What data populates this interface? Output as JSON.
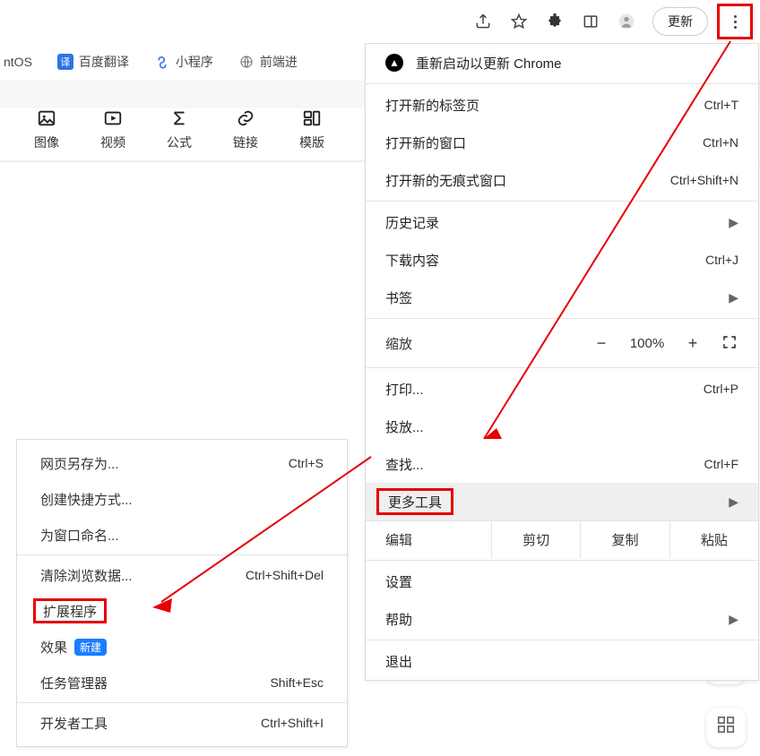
{
  "toolbar": {
    "update_label": "更新"
  },
  "bookmarks": [
    {
      "text": "ntOS"
    },
    {
      "text": "百度翻译",
      "icon": "translate"
    },
    {
      "text": "小程序",
      "icon": "miniapp"
    },
    {
      "text": "前端进",
      "icon": "globe"
    }
  ],
  "editor_tools": [
    {
      "glyph": "image",
      "label": "图像"
    },
    {
      "glyph": "video",
      "label": "视频"
    },
    {
      "glyph": "sigma",
      "label": "公式"
    },
    {
      "glyph": "link",
      "label": "链接"
    },
    {
      "glyph": "template",
      "label": "模版"
    }
  ],
  "menu": {
    "restart": "重新启动以更新 Chrome",
    "items1": [
      {
        "label": "打开新的标签页",
        "shortcut": "Ctrl+T"
      },
      {
        "label": "打开新的窗口",
        "shortcut": "Ctrl+N"
      },
      {
        "label": "打开新的无痕式窗口",
        "shortcut": "Ctrl+Shift+N"
      }
    ],
    "history": {
      "label": "历史记录"
    },
    "downloads": {
      "label": "下载内容",
      "shortcut": "Ctrl+J"
    },
    "bookmarks": {
      "label": "书签"
    },
    "zoom": {
      "label": "缩放",
      "value": "100%"
    },
    "print": {
      "label": "打印...",
      "shortcut": "Ctrl+P"
    },
    "cast": {
      "label": "投放..."
    },
    "find": {
      "label": "查找...",
      "shortcut": "Ctrl+F"
    },
    "more_tools": {
      "label": "更多工具"
    },
    "edit": {
      "label": "编辑",
      "cut": "剪切",
      "copy": "复制",
      "paste": "粘贴"
    },
    "settings": {
      "label": "设置"
    },
    "help": {
      "label": "帮助"
    },
    "exit": {
      "label": "退出"
    }
  },
  "submenu": {
    "save_as": {
      "label": "网页另存为...",
      "shortcut": "Ctrl+S"
    },
    "shortcut": {
      "label": "创建快捷方式..."
    },
    "name_window": {
      "label": "为窗口命名..."
    },
    "clear_data": {
      "label": "清除浏览数据...",
      "shortcut": "Ctrl+Shift+Del"
    },
    "extensions": {
      "label": "扩展程序"
    },
    "effects": {
      "label": "效果",
      "badge": "新建"
    },
    "task_manager": {
      "label": "任务管理器",
      "shortcut": "Shift+Esc"
    },
    "dev_tools": {
      "label": "开发者工具",
      "shortcut": "Ctrl+Shift+I"
    }
  }
}
